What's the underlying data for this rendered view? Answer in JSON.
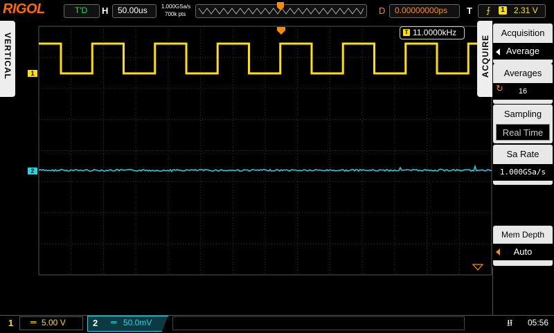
{
  "header": {
    "logo": "RIGOL",
    "run_state": "T'D",
    "horizontal_letter": "H",
    "timebase": "50.00us",
    "sample_rate": "1.000GSa/s",
    "memory_points": "700k pts",
    "delay_letter": "D",
    "delay": "0.00000000ps",
    "trigger_letter": "T",
    "trigger_source": "1",
    "trigger_level": "2.31 V"
  },
  "left_tab": {
    "label": "VERTICAL"
  },
  "display": {
    "ch1_marker": "1",
    "ch2_marker": "2",
    "frequency_icon": "T",
    "frequency": "11.0000kHz"
  },
  "acquire_menu": {
    "tab_label": "ACQUIRE",
    "items": [
      {
        "title": "Acquisition",
        "value": "Average"
      },
      {
        "title": "Averages",
        "value": "16"
      },
      {
        "title": "Sampling",
        "value": "Real Time"
      },
      {
        "title": "Sa Rate",
        "value": "1.000GSa/s"
      },
      {
        "title": "Mem Depth",
        "value": "Auto"
      }
    ]
  },
  "footer": {
    "ch1_number": "1",
    "ch1_coupling": "═",
    "ch1_scale": "5.00 V",
    "ch2_number": "2",
    "ch2_coupling": "═",
    "ch2_scale": "50.0mV",
    "clock": "05:56"
  },
  "colors": {
    "ch1": "#ffe000",
    "ch2": "#25d5e5",
    "accent": "#ff8c00",
    "run_state": "#1fe050"
  },
  "icons": [
    "trigger-edge-icon",
    "trigger-position-icon",
    "usb-icon",
    "menu-arrow-icon",
    "knob-icon"
  ]
}
